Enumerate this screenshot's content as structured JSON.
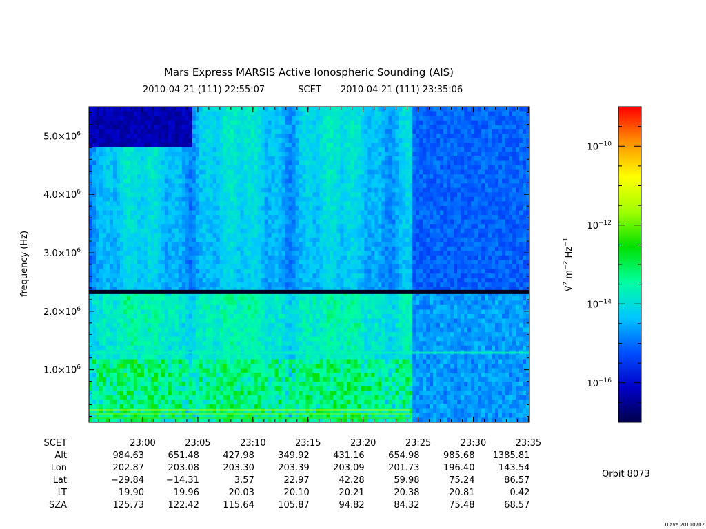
{
  "chart_data": {
    "type": "heatmap",
    "title": "Mars Express MARSIS Active Ionospheric Sounding (AIS)",
    "subtitle": {
      "start": "2010-04-21 (111) 22:55:07",
      "center": "SCET",
      "end": "2010-04-21 (111) 23:35:06"
    },
    "ylabel": "frequency (Hz)",
    "ylim": [
      100000,
      5500000
    ],
    "y_ticks": [
      {
        "value": 1000000,
        "mantissa": "1.0×10",
        "exp": "6"
      },
      {
        "value": 2000000,
        "mantissa": "2.0×10",
        "exp": "6"
      },
      {
        "value": 3000000,
        "mantissa": "3.0×10",
        "exp": "6"
      },
      {
        "value": 4000000,
        "mantissa": "4.0×10",
        "exp": "6"
      },
      {
        "value": 5000000,
        "mantissa": "5.0×10",
        "exp": "6"
      }
    ],
    "xlim": [
      "22:55:07",
      "23:35:06"
    ],
    "x_ticks": [
      "23:00",
      "23:05",
      "23:10",
      "23:15",
      "23:20",
      "23:25",
      "23:30",
      "23:35"
    ],
    "ephemeris": {
      "row_labels": [
        "SCET",
        "Alt",
        "Lon",
        "Lat",
        "LT",
        "SZA"
      ],
      "columns": [
        {
          "scet": "23:00",
          "alt": "984.63",
          "lon": "202.87",
          "lat": "−29.84",
          "lt": "19.90",
          "sza": "125.73"
        },
        {
          "scet": "23:05",
          "alt": "651.48",
          "lon": "203.08",
          "lat": "−14.31",
          "lt": "19.96",
          "sza": "122.42"
        },
        {
          "scet": "23:10",
          "alt": "427.98",
          "lon": "203.30",
          "lat": "3.57",
          "lt": "20.03",
          "sza": "115.64"
        },
        {
          "scet": "23:15",
          "alt": "349.92",
          "lon": "203.39",
          "lat": "22.97",
          "lt": "20.10",
          "sza": "105.87"
        },
        {
          "scet": "23:20",
          "alt": "431.16",
          "lon": "203.09",
          "lat": "42.28",
          "lt": "20.21",
          "sza": "94.82"
        },
        {
          "scet": "23:25",
          "alt": "654.98",
          "lon": "201.73",
          "lat": "59.98",
          "lt": "20.38",
          "sza": "84.32"
        },
        {
          "scet": "23:30",
          "alt": "985.68",
          "lon": "196.40",
          "lat": "75.24",
          "lt": "20.81",
          "sza": "75.48"
        },
        {
          "scet": "23:35",
          "alt": "1385.81",
          "lon": "143.54",
          "lat": "86.57",
          "lt": "0.42",
          "sza": "68.57"
        }
      ]
    },
    "colorbar": {
      "label_parts": [
        "V",
        "2",
        " m",
        "−2",
        " Hz",
        "−1"
      ],
      "log_range": [
        -17,
        -9
      ],
      "ticks": [
        {
          "log": -10,
          "base": "10",
          "exp": "−10"
        },
        {
          "log": -12,
          "base": "10",
          "exp": "−12"
        },
        {
          "log": -14,
          "base": "10",
          "exp": "−14"
        },
        {
          "log": -16,
          "base": "10",
          "exp": "−16"
        }
      ],
      "colors": [
        "#00004a",
        "#0000c8",
        "#0050ff",
        "#00c8ff",
        "#00ffa0",
        "#00e000",
        "#a0ff00",
        "#ffff00",
        "#ff9000",
        "#ff0000"
      ]
    }
  },
  "orbit": "Orbit 8073",
  "footer": "Ulave 20110702"
}
